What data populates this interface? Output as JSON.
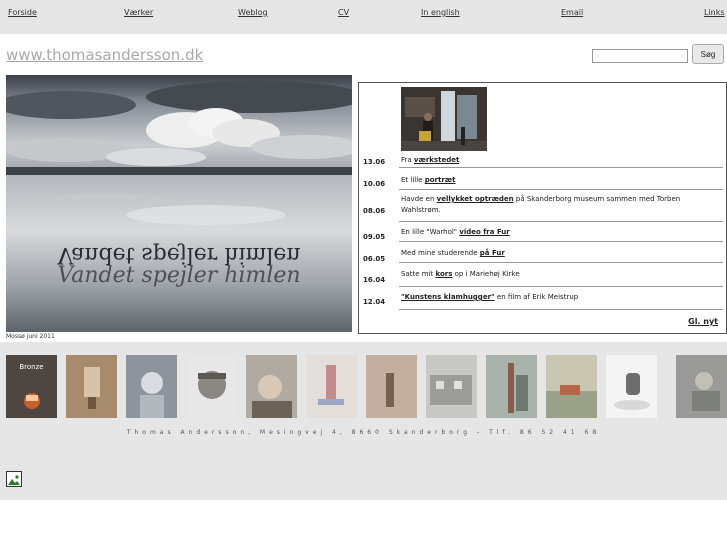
{
  "nav": {
    "items": [
      "Forside",
      "Værker",
      "Weblog",
      "CV",
      "In english",
      "Email",
      "Links"
    ]
  },
  "site": {
    "title": "www.thomasandersson.dk",
    "search_button": "Søg"
  },
  "hero": {
    "reflected_text_1": "Vandet spejler himlen",
    "reflected_text_2": "Vandet spejler himlen",
    "caption": "Mossø juni 2011"
  },
  "news": {
    "entries": [
      {
        "date": "13.06",
        "pre": "Fra ",
        "link": "værkstedet",
        "post": ""
      },
      {
        "date": "10.06",
        "pre": "Et lille ",
        "link": "portræt",
        "post": ""
      },
      {
        "date": "08.06",
        "pre": "Havde en ",
        "link": "vellykket optræden",
        "post": " på Skanderborg museum sammen med Torben Wahlstrøm."
      },
      {
        "date": "09.05",
        "pre": "En lille \"Warhol\" ",
        "link": "video fra Fur",
        "post": ""
      },
      {
        "date": "06.05",
        "pre": "Med mine studerende ",
        "link": "på Fur",
        "post": ""
      },
      {
        "date": "16.04",
        "pre": "Satte mit ",
        "link": "kors",
        "post": " op i Mariehøj Kirke"
      },
      {
        "date": "12.04",
        "pre": "",
        "link": "\"Kunstens klamhugger\"",
        "post": " en film af Erik Meistrup"
      }
    ],
    "older_link": "Gl. nyt"
  },
  "gallery": {
    "first_label": "Bronze",
    "thumb_count": 12
  },
  "footer": {
    "address": "Thomas Andersson, Mesingvej 4, 8660 Skanderborg - Tlf. 86 52 41 68"
  }
}
